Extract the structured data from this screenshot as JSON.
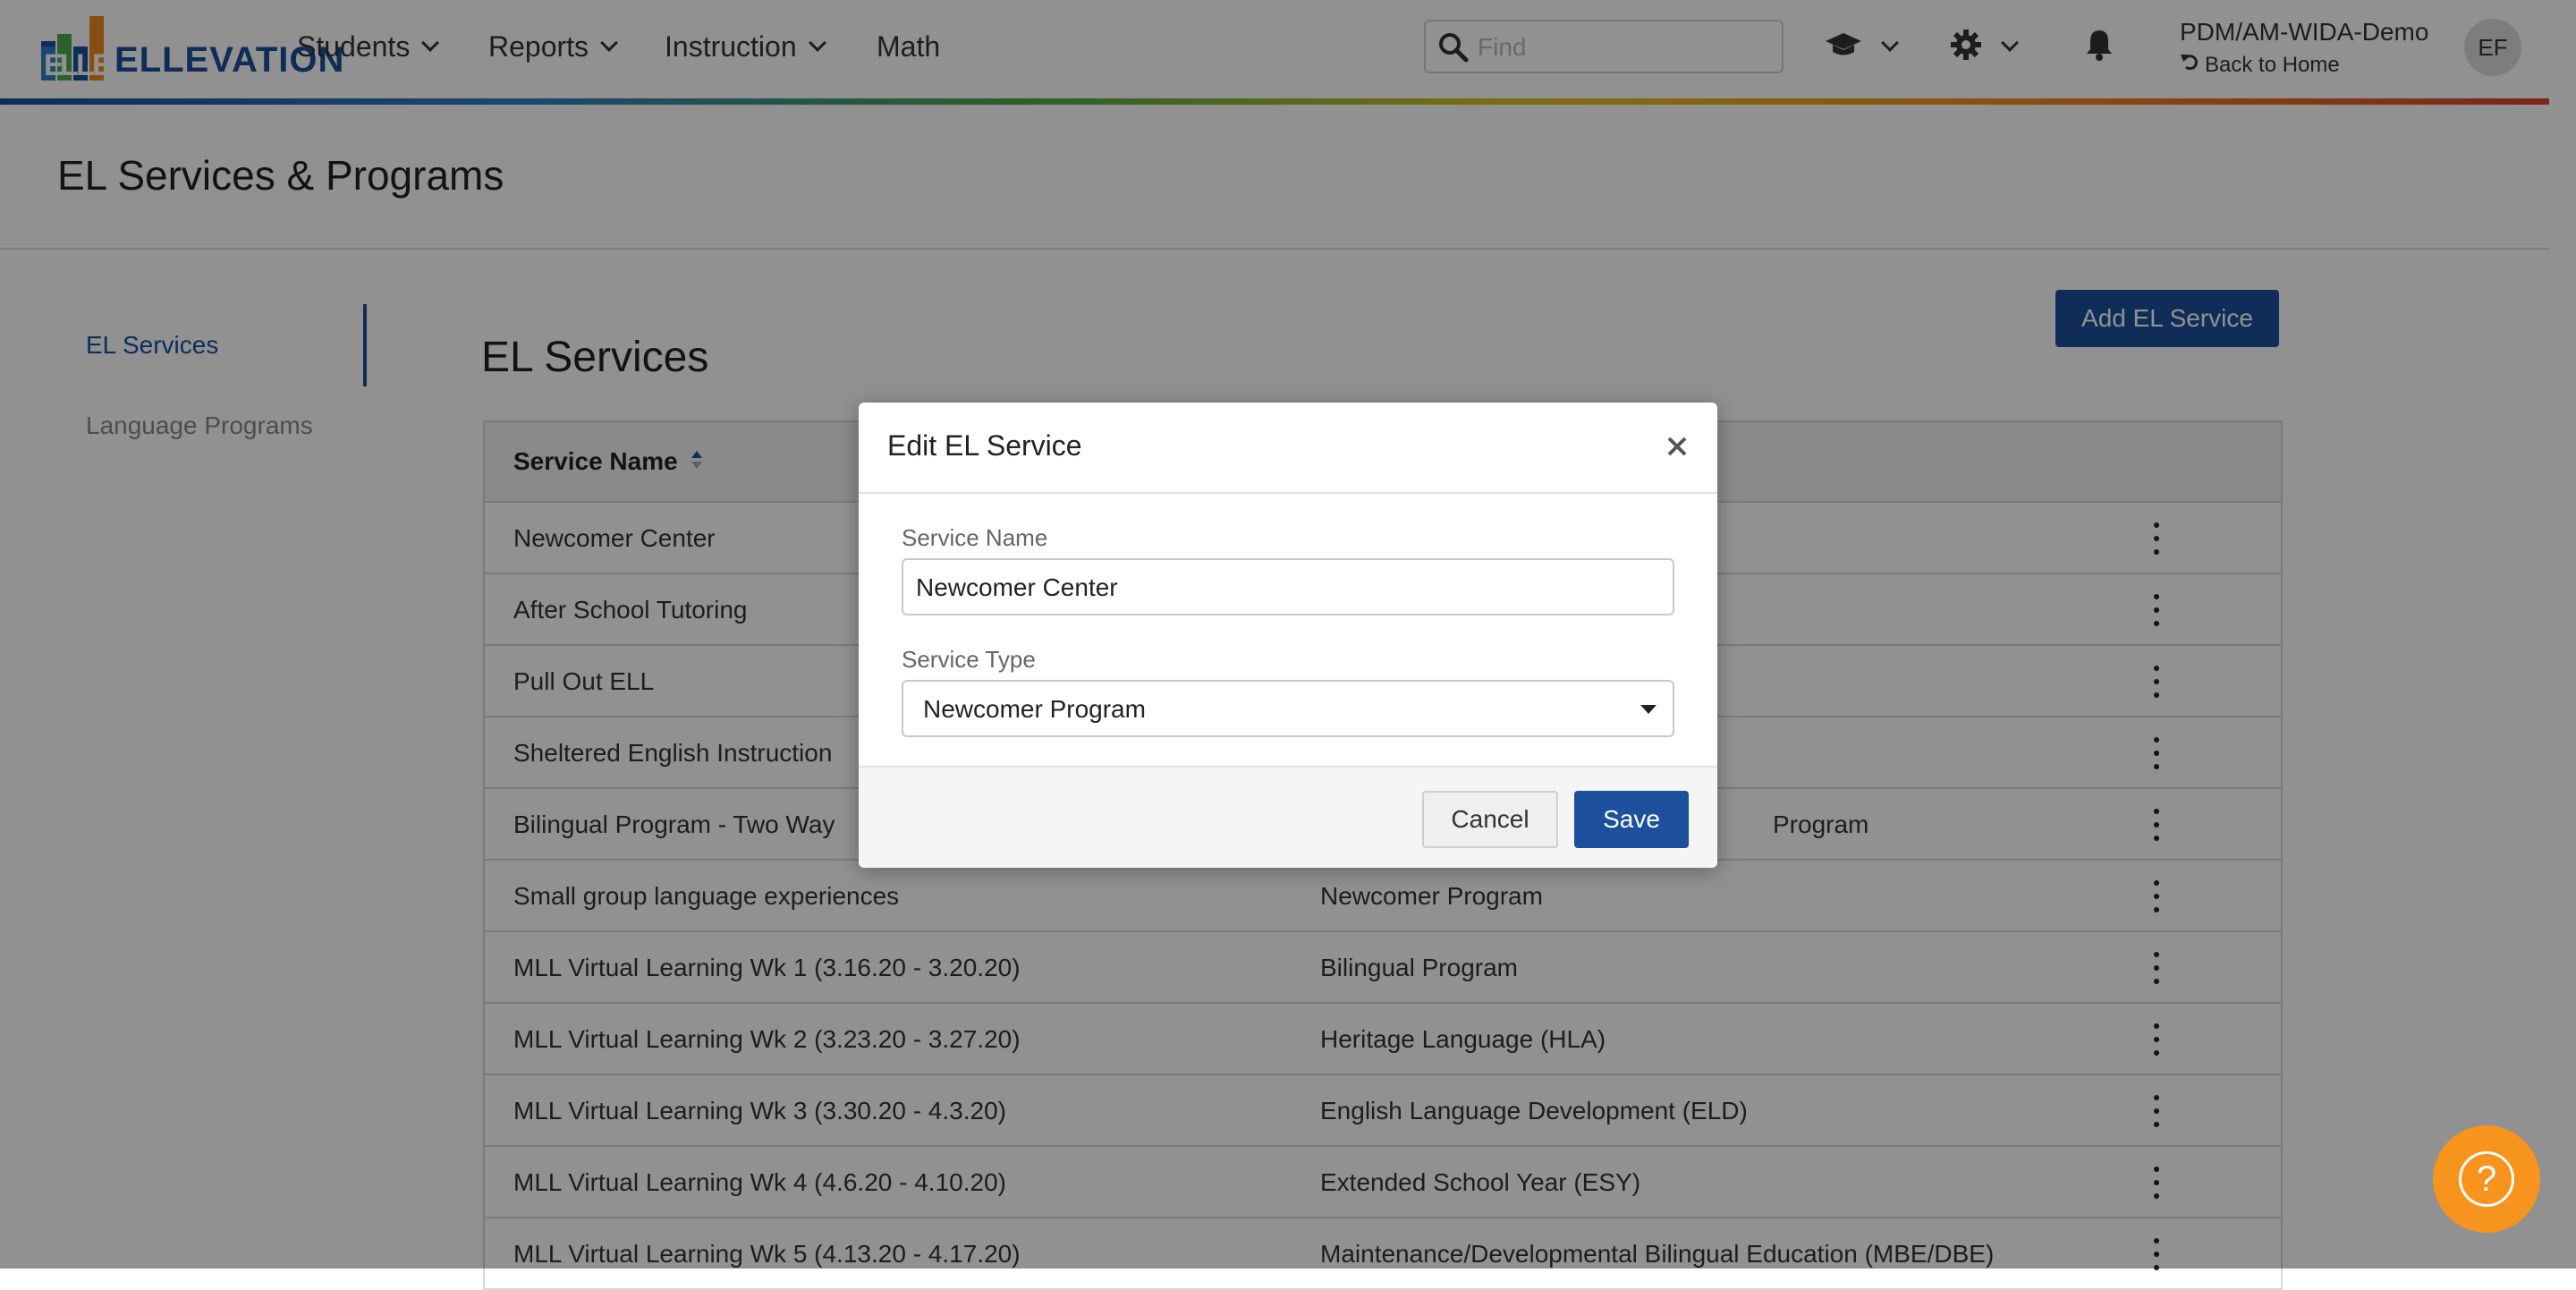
{
  "app": {
    "logo_text": "ELLEVATION",
    "colors": {
      "brand_blue": "#1c4f9c",
      "help_orange": "#f7941d"
    }
  },
  "nav": {
    "items": [
      {
        "label": "Students",
        "dropdown": true
      },
      {
        "label": "Reports",
        "dropdown": true
      },
      {
        "label": "Instruction",
        "dropdown": true
      },
      {
        "label": "Math",
        "dropdown": false
      }
    ],
    "search_placeholder": "Find",
    "org_name": "PDM/AM-WIDA-Demo",
    "back_to_home": "Back to Home",
    "avatar_initials": "EF",
    "icons": [
      "search-icon",
      "graduation-cap-icon",
      "gear-icon",
      "bell-icon"
    ]
  },
  "page": {
    "title": "EL Services & Programs"
  },
  "sidebar": {
    "items": [
      {
        "label": "EL Services",
        "active": true
      },
      {
        "label": "Language Programs",
        "active": false
      }
    ]
  },
  "main": {
    "title": "EL Services",
    "add_button": "Add EL Service",
    "table": {
      "column_service_name": "Service Name",
      "rows": [
        {
          "name": "Newcomer Center",
          "type": ""
        },
        {
          "name": "After School Tutoring",
          "type": ""
        },
        {
          "name": "Pull Out ELL",
          "type": ""
        },
        {
          "name": "Sheltered English Instruction",
          "type": ""
        },
        {
          "name": "Bilingual Program - Two Way",
          "type": "Program"
        },
        {
          "name": "Small group language experiences",
          "type": "Newcomer Program"
        },
        {
          "name": "MLL Virtual Learning Wk 1 (3.16.20 - 3.20.20)",
          "type": "Bilingual Program"
        },
        {
          "name": "MLL Virtual Learning Wk 2 (3.23.20 - 3.27.20)",
          "type": "Heritage Language (HLA)"
        },
        {
          "name": "MLL Virtual Learning Wk 3 (3.30.20 - 4.3.20)",
          "type": "English Language Development (ELD)"
        },
        {
          "name": "MLL Virtual Learning Wk 4 (4.6.20 - 4.10.20)",
          "type": "Extended School Year (ESY)"
        },
        {
          "name": "MLL Virtual Learning Wk 5 (4.13.20 - 4.17.20)",
          "type": "Maintenance/Developmental Bilingual Education (MBE/DBE)"
        }
      ]
    }
  },
  "modal": {
    "title": "Edit EL Service",
    "service_name_label": "Service Name",
    "service_name_value": "Newcomer Center",
    "service_type_label": "Service Type",
    "service_type_value": "Newcomer Program",
    "cancel_label": "Cancel",
    "save_label": "Save"
  },
  "help": {
    "label": "?"
  }
}
